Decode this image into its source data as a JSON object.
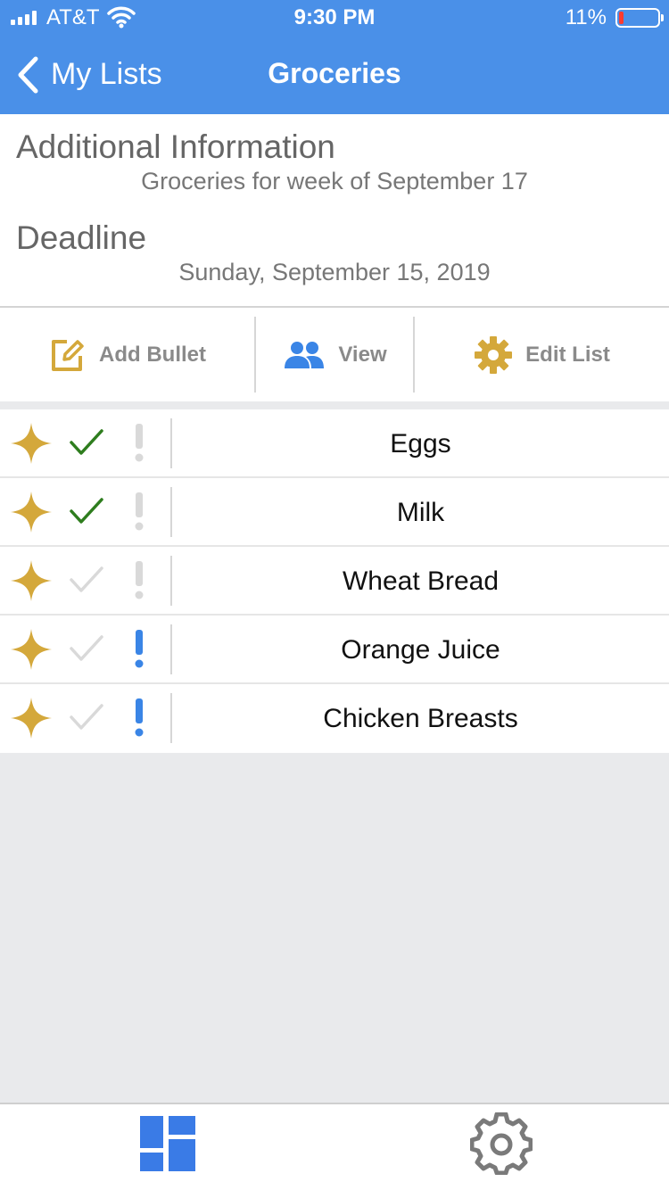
{
  "status_bar": {
    "carrier": "AT&T",
    "time": "9:30 PM",
    "battery_percent": "11%",
    "battery_level": 0.11
  },
  "nav": {
    "back_label": "My Lists",
    "title": "Groceries"
  },
  "info": {
    "additional_title": "Additional Information",
    "additional_value": "Groceries for week of September 17",
    "deadline_title": "Deadline",
    "deadline_value": "Sunday, September 15, 2019"
  },
  "toolbar": {
    "add_bullet": "Add Bullet",
    "view": "View",
    "edit_list": "Edit List"
  },
  "items": [
    {
      "name": "Eggs",
      "checked": true,
      "important": false
    },
    {
      "name": "Milk",
      "checked": true,
      "important": false
    },
    {
      "name": "Wheat Bread",
      "checked": false,
      "important": false
    },
    {
      "name": "Orange Juice",
      "checked": false,
      "important": true
    },
    {
      "name": "Chicken Breasts",
      "checked": false,
      "important": true
    }
  ],
  "colors": {
    "header_blue": "#4a90e8",
    "gold": "#d4a83b",
    "check_green": "#2e7d1e",
    "inactive_gray": "#d9d9d9",
    "important_blue": "#3a85e6",
    "tab_active": "#3a7be6"
  },
  "icons": {
    "add_bullet": "edit-icon",
    "view": "people-icon",
    "edit_list": "gear-icon",
    "tab_home": "dashboard-icon",
    "tab_settings": "gear-icon"
  }
}
